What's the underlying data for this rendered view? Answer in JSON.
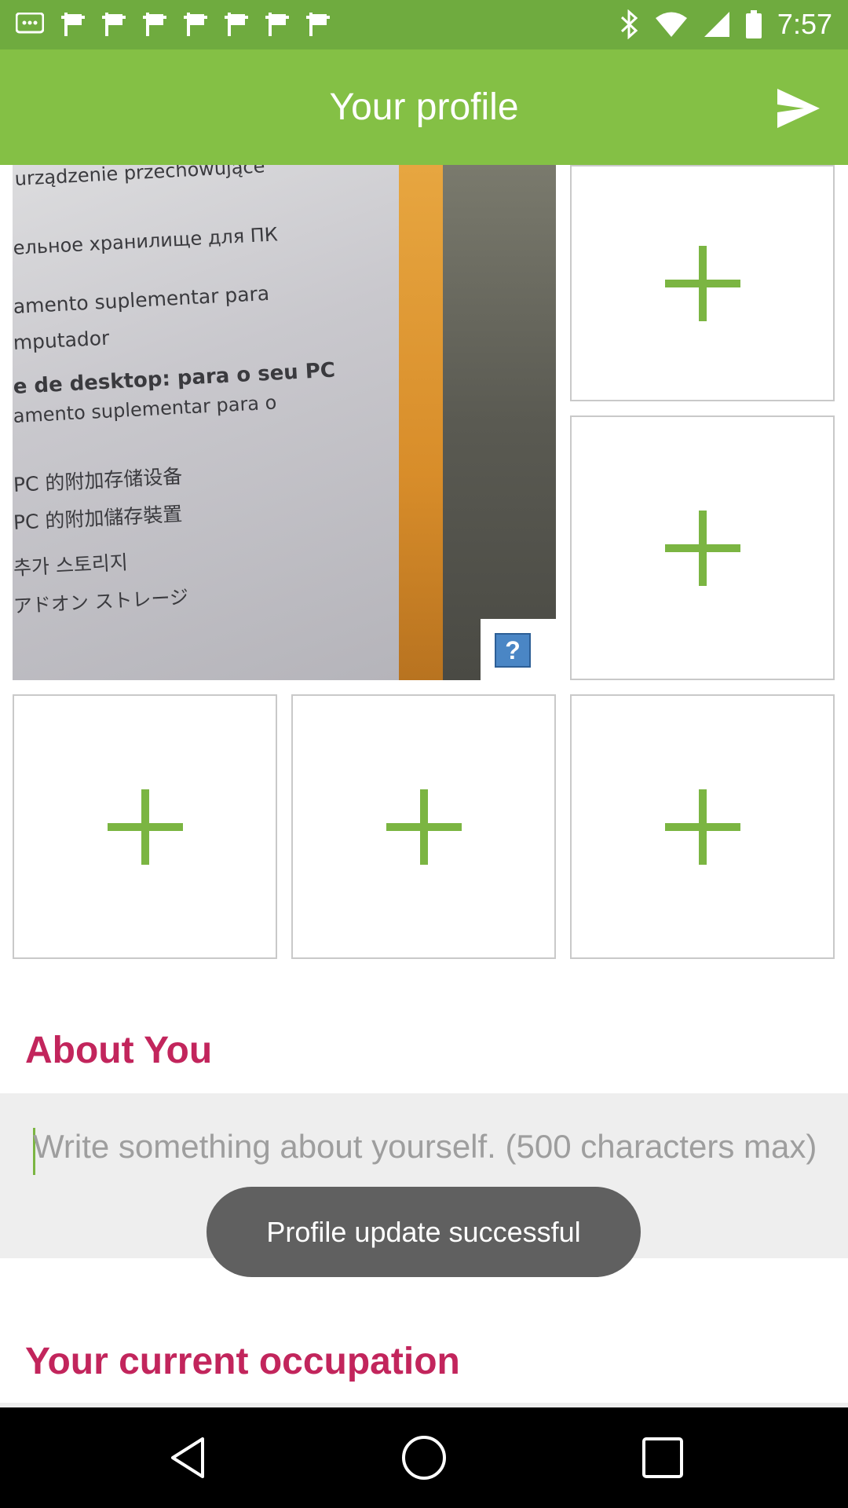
{
  "status_bar": {
    "time": "7:57",
    "left_icons": [
      "message-icon",
      "flag-icon",
      "flag-icon",
      "flag-icon",
      "flag-icon",
      "flag-icon",
      "flag-icon",
      "flag-icon"
    ],
    "right_icons": [
      "bluetooth-icon",
      "wifi-icon",
      "signal-icon",
      "battery-icon"
    ]
  },
  "app_bar": {
    "title": "Your profile",
    "action_icon": "send-icon"
  },
  "photo": {
    "text_lines": [
      "urządzenie przechowujące",
      "ельное хранилище для ПК",
      "amento suplementar para",
      "mputador",
      "e de desktop: para o seu PC",
      "amento suplementar para o",
      "PC 的附加存储设备",
      "PC 的附加儲存裝置",
      "추가 스토리지",
      "アドオン ストレージ"
    ],
    "help_label": "?"
  },
  "slots": {
    "count_empty": 5,
    "icon": "plus-icon"
  },
  "about": {
    "title": "About You",
    "placeholder": "Write something about yourself. (500 characters max)"
  },
  "toast": {
    "text": "Profile update successful"
  },
  "occupation": {
    "title": "Your current occupation"
  },
  "nav_bar": {
    "icons": [
      "back-icon",
      "home-icon",
      "recents-icon"
    ]
  },
  "colors": {
    "status_bar": "#6fab3f",
    "app_bar": "#84c045",
    "accent_green": "#7bb542",
    "section_title": "#c2255c"
  }
}
